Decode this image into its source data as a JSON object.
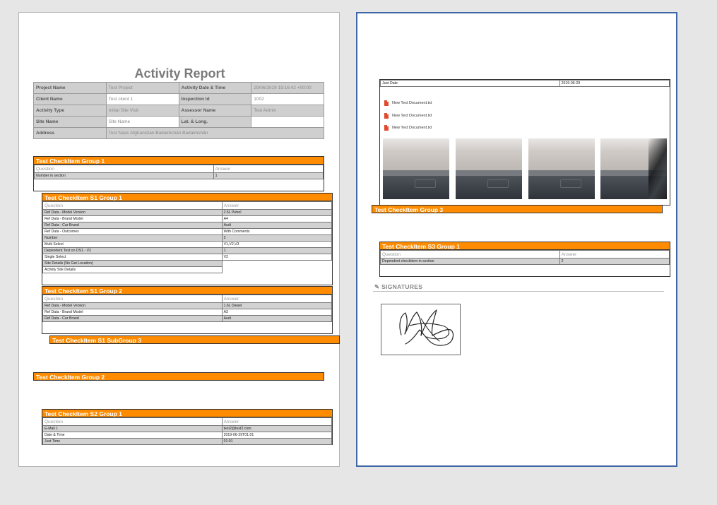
{
  "page1": {
    "title": "Activity Report",
    "info": [
      [
        {
          "label": "Project Name",
          "value": "Test Project"
        },
        {
          "label": "Activity Date & Time",
          "value": "29/06/2019 19:16:42 +00:00"
        }
      ],
      [
        {
          "label": "Client Name",
          "value": "Test client 1"
        },
        {
          "label": "Inspection Id",
          "value": "1002"
        }
      ],
      [
        {
          "label": "Activity Type",
          "value": "Initial Site Visit"
        },
        {
          "label": "Assessor Name",
          "value": "Test Admin"
        }
      ],
      [
        {
          "label": "Site Name",
          "value": "Site Name"
        },
        {
          "label": "Lat. & Long.",
          "value": ""
        }
      ],
      [
        {
          "label": "Address",
          "value": "Test Naas Afghanistan Badakhshān Badakhshān"
        }
      ]
    ],
    "sections": [
      {
        "title": "Test CheckItem Group 1",
        "header": [
          "Question",
          "Answer"
        ],
        "rows": [
          [
            "Number in section",
            "1"
          ]
        ]
      },
      {
        "title": "Test CheckItem S1 Group 1",
        "header": [
          "Question",
          "Answer"
        ],
        "rows": [
          [
            "Ref Data - Model Version",
            "2.5L Petrol"
          ],
          [
            "Ref Data - Brand Model",
            "A4"
          ],
          [
            "Ref Data - Car Brand",
            "Audi"
          ],
          [
            "Ref Data - Outcomes",
            "With Comments"
          ],
          [
            "Number",
            "2"
          ],
          [
            "Multi Select",
            "V1,V2,V3"
          ],
          [
            "Dependent Text on DS1 - V2",
            "1"
          ],
          [
            "Single Select",
            "V2"
          ],
          [
            "Site Details (No Get Location)",
            ""
          ],
          [
            "Activity Site Details",
            ""
          ]
        ]
      },
      {
        "title": "Test CheckItem S1 Group 2",
        "header": [
          "Question",
          "Answer"
        ],
        "rows": [
          [
            "Ref Data - Model Version",
            "1.6L Diesel"
          ],
          [
            "Ref Data - Brand Model",
            "A3"
          ],
          [
            "Ref Data - Car Brand",
            "Audi"
          ]
        ]
      },
      {
        "title": "Test CheckItem S1 SubGroup 3"
      },
      {
        "title": "Test CheckItem Group 2"
      },
      {
        "title": "Test CheckItem S2 Group 1",
        "header": [
          "Question",
          "Answer"
        ],
        "rows": [
          [
            "E-Mail 1",
            "test2@test2.com"
          ],
          [
            "Date & Time",
            "2019-06-29T01:01"
          ],
          [
            "Just Time",
            "01:01"
          ]
        ]
      }
    ]
  },
  "page2": {
    "top_row": [
      "Just Date",
      "2019-06-29"
    ],
    "files": [
      "New Text Document.txt",
      "New Text Document.txt",
      "New Text Document.txt"
    ],
    "sections": [
      {
        "title": "Test CheckItem Group 3"
      },
      {
        "title": "Test CheckItem S3 Group 1",
        "header": [
          "Question",
          "Answer"
        ],
        "rows": [
          [
            "Dependent checkitem in section",
            "2"
          ]
        ]
      }
    ],
    "signatures_label": "SIGNATURES"
  },
  "colors": {
    "section_header": "#ff8c00",
    "page2_border": "#3f66a6",
    "label_bg": "#cfcfcf"
  }
}
